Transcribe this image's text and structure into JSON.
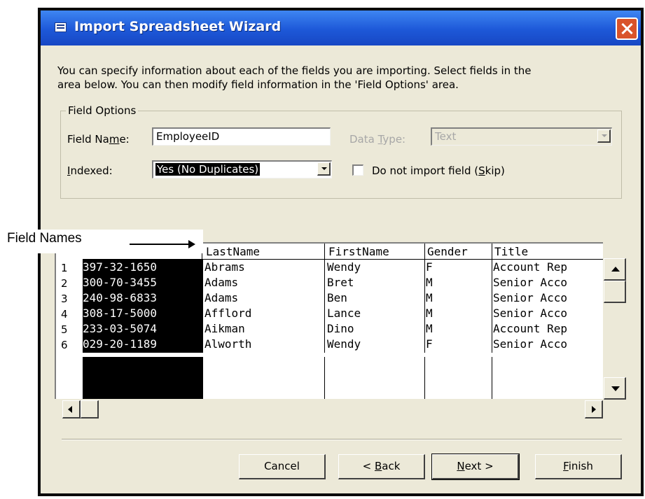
{
  "window": {
    "title": "Import Spreadsheet Wizard"
  },
  "description": {
    "line1": "You can specify information about each of the fields you are importing.  Select fields in the",
    "line2": "area below. You can then modify field information in the 'Field Options' area."
  },
  "field_options": {
    "legend": "Field Options",
    "field_name_label_pre": "Field Na",
    "field_name_label_u": "m",
    "field_name_label_post": "e:",
    "field_name_value": "EmployeeID",
    "data_type_label_pre": "Data ",
    "data_type_label_u": "T",
    "data_type_label_post": "ype:",
    "data_type_value": "Text",
    "indexed_label_u": "I",
    "indexed_label_post": "ndexed:",
    "indexed_value": "Yes (No Duplicates)",
    "skip_label_pre": "Do not import field (",
    "skip_label_u": "S",
    "skip_label_post": "kip)",
    "skip_checked": false
  },
  "annotation": {
    "label": "Field Names"
  },
  "grid": {
    "headers": [
      "LastName",
      "FirstName",
      "Gender",
      "Title"
    ],
    "rows": [
      {
        "num": "1",
        "id": "397-32-1650",
        "last": "Abrams",
        "first": "Wendy",
        "gender": "F",
        "title": "Account Rep"
      },
      {
        "num": "2",
        "id": "300-70-3455",
        "last": "Adams",
        "first": "Bret",
        "gender": "M",
        "title": "Senior Acco"
      },
      {
        "num": "3",
        "id": "240-98-6833",
        "last": "Adams",
        "first": "Ben",
        "gender": "M",
        "title": "Senior Acco"
      },
      {
        "num": "4",
        "id": "308-17-5000",
        "last": "Afflord",
        "first": "Lance",
        "gender": "M",
        "title": "Senior Acco"
      },
      {
        "num": "5",
        "id": "233-03-5074",
        "last": "Aikman",
        "first": "Dino",
        "gender": "M",
        "title": "Account Rep"
      },
      {
        "num": "6",
        "id": "029-20-1189",
        "last": "Alworth",
        "first": "Wendy",
        "gender": "F",
        "title": "Senior Acco"
      }
    ]
  },
  "buttons": {
    "cancel": "Cancel",
    "back_pre": "< ",
    "back_u": "B",
    "back_post": "ack",
    "next_u": "N",
    "next_post": "ext >",
    "finish_u": "F",
    "finish_post": "inish"
  },
  "colors": {
    "titlebar": "#1d58d8",
    "dialog": "#ece9d8",
    "selection": "#000000"
  }
}
